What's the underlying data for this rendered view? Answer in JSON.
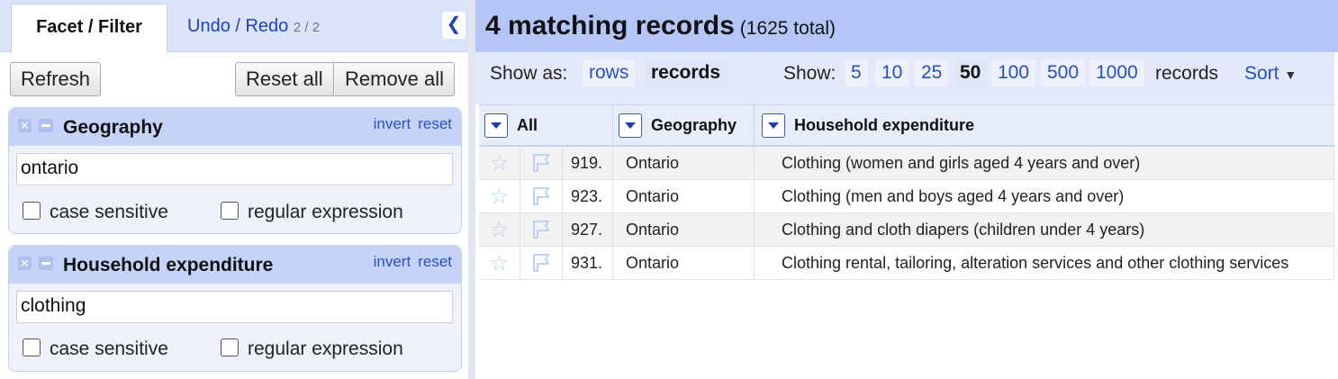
{
  "left_panel": {
    "tabs": {
      "facet": "Facet / Filter",
      "undo": "Undo / Redo",
      "undo_count": "2 / 2"
    },
    "collapse_icon": "chevron-left-icon",
    "buttons": {
      "refresh": "Refresh",
      "reset_all": "Reset all",
      "remove_all": "Remove all"
    },
    "facets": [
      {
        "title": "Geography",
        "invert": "invert",
        "reset": "reset",
        "value": "ontario",
        "case_sensitive": "case sensitive",
        "regex": "regular expression"
      },
      {
        "title": "Household expenditure",
        "invert": "invert",
        "reset": "reset",
        "value": "clothing",
        "case_sensitive": "case sensitive",
        "regex": "regular expression"
      }
    ]
  },
  "summary": {
    "count": "4 matching records",
    "total": "(1625 total)"
  },
  "viewbar": {
    "show_as": "Show as:",
    "rows": "rows",
    "records": "records",
    "show": "Show:",
    "page_sizes": [
      "5",
      "10",
      "25",
      "50",
      "100",
      "500",
      "1000"
    ],
    "selected_page_size": "50",
    "records_label": "records",
    "sort": "Sort"
  },
  "grid": {
    "columns": [
      "All",
      "Geography",
      "Household expenditure"
    ],
    "rows": [
      {
        "num": "919.",
        "geography": "Ontario",
        "expenditure": "Clothing (women and girls aged 4 years and over)"
      },
      {
        "num": "923.",
        "geography": "Ontario",
        "expenditure": "Clothing (men and boys aged 4 years and over)"
      },
      {
        "num": "927.",
        "geography": "Ontario",
        "expenditure": "Clothing and cloth diapers (children under 4 years)"
      },
      {
        "num": "931.",
        "geography": "Ontario",
        "expenditure": "Clothing rental, tailoring, alteration services and other clothing services"
      }
    ]
  },
  "colors": {
    "accent": "#2550c8",
    "header": "#b4c6f8",
    "facet_head": "#c6d3f8"
  }
}
